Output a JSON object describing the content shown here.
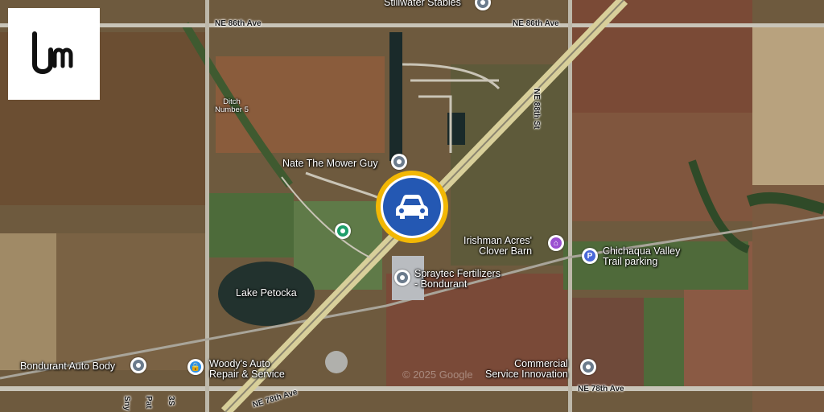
{
  "map": {
    "roads": {
      "ne_86th_west": "NE 86th Ave",
      "ne_86th_east": "NE 86th Ave",
      "ne_88th_st": "NE 88th St",
      "ne_78th_west": "NE 78th Ave",
      "ne_78th_east": "NE 78th Ave",
      "sny": "Sny",
      "pat": "Pat",
      "s3": "3S"
    },
    "places": {
      "stillwater": "Stillwater Stables",
      "ditch": "Ditch\nNumber 5",
      "nate": "Nate The Mower Guy",
      "irishman": "Irishman Acres'\nClover Barn",
      "chichaqua": "Chichaqua Valley\nTrail parking",
      "spraytec": "Spraytec Fertilizers\n- Bondurant",
      "lake": "Lake Petocka",
      "bondurant_auto": "Bondurant Auto Body",
      "woodys": "Woody's Auto\nRepair & Service",
      "commercial": "Commercial\nService Innovation"
    },
    "watermark": "© 2025 Google",
    "marker": {
      "icon": "car-icon",
      "ring_color": "#f2b705",
      "core_color": "#2458b3"
    },
    "pin_colors": {
      "gray": "#6b7b8c",
      "purple": "#9a4fd1",
      "blue": "#4a68d8",
      "green": "#1e9e6a",
      "shop": "#2b8fe6"
    },
    "parking_symbol": "P"
  },
  "logo": {
    "icon": "um-logo-icon"
  }
}
